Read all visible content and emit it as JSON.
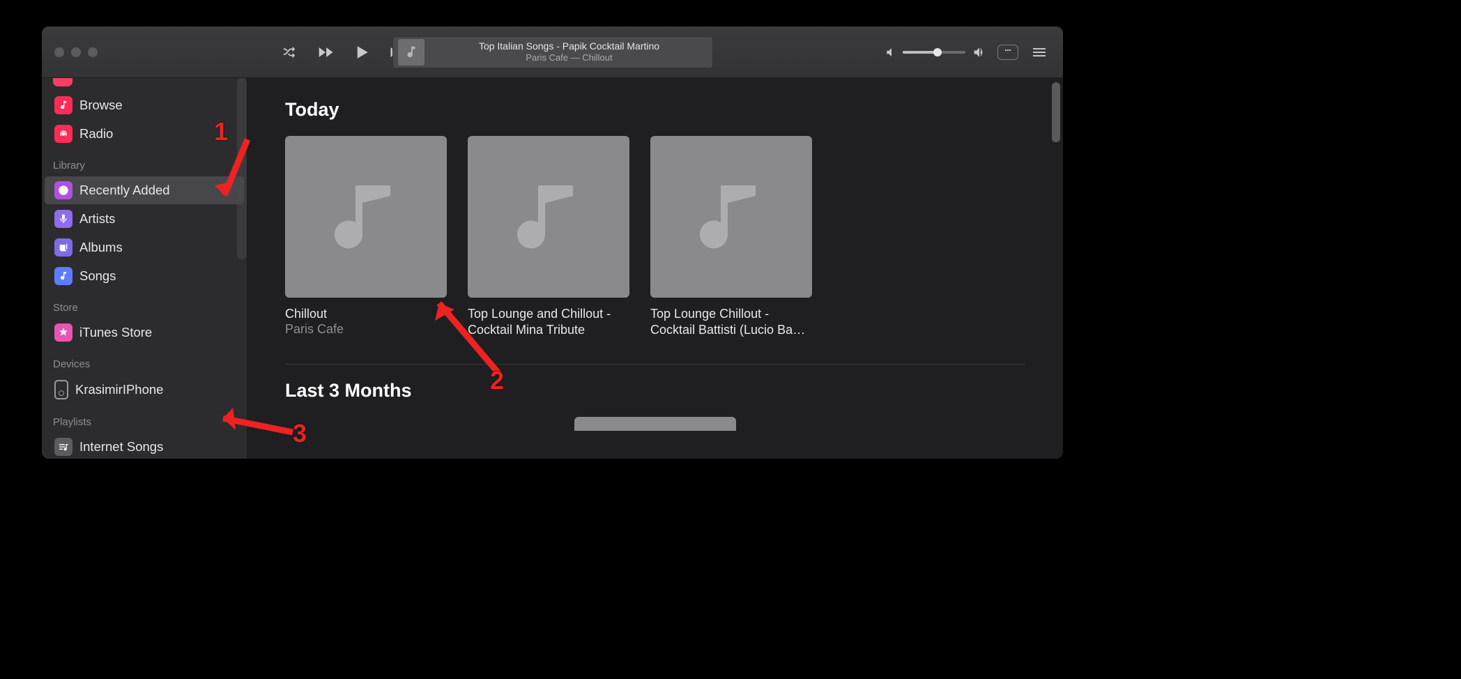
{
  "toolbar": {
    "now_playing_title": "Top Italian Songs - Papik Cocktail Martino",
    "now_playing_sub": "Paris Cafe — Chillout"
  },
  "sidebar": {
    "top": [
      {
        "label": "Browse",
        "icon": "music-note-icon"
      },
      {
        "label": "Radio",
        "icon": "radio-icon"
      }
    ],
    "library_header": "Library",
    "library": [
      {
        "label": "Recently Added",
        "icon": "clock-icon",
        "selected": true
      },
      {
        "label": "Artists",
        "icon": "mic-icon"
      },
      {
        "label": "Albums",
        "icon": "albums-icon"
      },
      {
        "label": "Songs",
        "icon": "note-icon"
      }
    ],
    "store_header": "Store",
    "store": [
      {
        "label": "iTunes Store",
        "icon": "star-icon"
      }
    ],
    "devices_header": "Devices",
    "devices": [
      {
        "label": "KrasimirIPhone",
        "icon": "phone-icon"
      }
    ],
    "playlists_header": "Playlists",
    "playlists": [
      {
        "label": "Internet Songs",
        "icon": "playlist-icon"
      }
    ]
  },
  "main": {
    "section1_title": "Today",
    "cards": [
      {
        "title": "Chillout",
        "sub": "Paris Cafe"
      },
      {
        "title": "Top Lounge and Chillout - Cocktail Mina Tribute",
        "sub": ""
      },
      {
        "title": "Top Lounge Chillout - Cocktail Battisti (Lucio Ba…",
        "sub": ""
      }
    ],
    "section2_title": "Last 3 Months"
  },
  "annotations": {
    "n1": "1",
    "n2": "2",
    "n3": "3"
  }
}
